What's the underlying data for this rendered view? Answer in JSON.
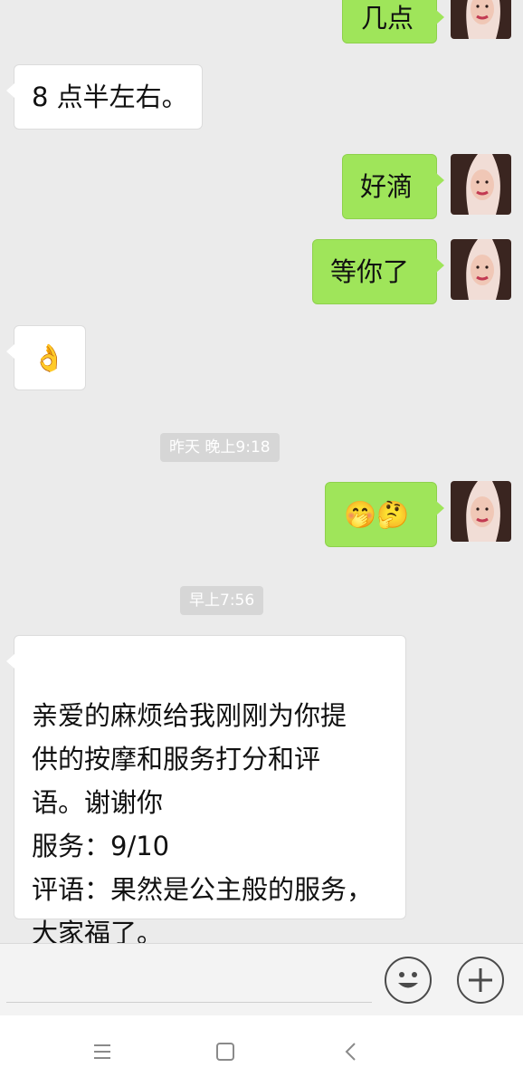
{
  "messages": [
    {
      "direction": "out",
      "text": "几点"
    },
    {
      "direction": "in",
      "text": "8 点半左右。"
    },
    {
      "direction": "out",
      "text": "好滴"
    },
    {
      "direction": "out",
      "text": "等你了"
    },
    {
      "direction": "in",
      "text": "👌"
    },
    {
      "direction": "out",
      "text": "🤭🤔"
    },
    {
      "direction": "in",
      "text": "亲爱的麻烦给我刚刚为你提\n供的按摩和服务打分和评\n语。谢谢你\n服务：9/10\n评语：果然是公主般的服务，\n大家福了。"
    }
  ],
  "timestamps": {
    "yesterday": "昨天 晚上9:18",
    "morning": "早上7:56"
  },
  "input": {
    "placeholder": ""
  },
  "icons": {
    "emoji_button": "emoji-icon",
    "plus_button": "plus-icon",
    "nav_menu": "menu-icon",
    "nav_home": "home-square-icon",
    "nav_back": "back-chevron-icon"
  },
  "colors": {
    "background": "#ebebeb",
    "outgoing_bubble": "#9fe55a",
    "incoming_bubble": "#ffffff",
    "time_chip": "#d6d6d6"
  }
}
